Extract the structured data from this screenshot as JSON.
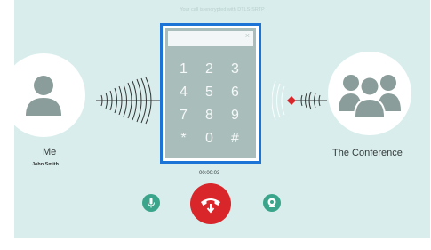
{
  "header": {
    "encryption_note": "Your call is encrypted with DTLS-SRTP"
  },
  "participants": {
    "me": {
      "label": "Me",
      "sub_label": "John Smith"
    },
    "conference": {
      "label": "The Conference"
    }
  },
  "keypad": {
    "close_label": "×",
    "keys": [
      "1",
      "2",
      "3",
      "4",
      "5",
      "6",
      "7",
      "8",
      "9",
      "*",
      "0",
      "#"
    ]
  },
  "call": {
    "timer": "00:00:03"
  },
  "controls": {
    "mic_icon": "microphone-icon",
    "hangup_icon": "phone-hangup-icon",
    "cam_icon": "video-icon"
  },
  "colors": {
    "background": "#d9eeec",
    "accent_green": "#3aa58a",
    "hangup_red": "#d8262a",
    "keypad_border": "#1b74d6",
    "keypad_grey": "#a9bdba"
  }
}
